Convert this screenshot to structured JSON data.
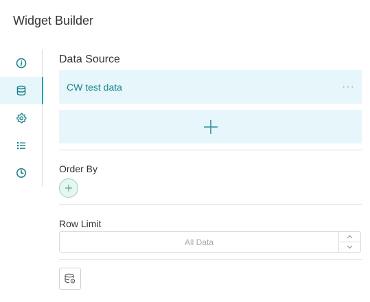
{
  "header": {
    "title": "Widget Builder"
  },
  "sidebar": {
    "active_index": 1,
    "icons": [
      "info-icon",
      "database-icon",
      "gear-icon",
      "list-icon",
      "clock-icon"
    ],
    "accent_color": "#1fa6a0",
    "icon_color": "#1a7f8a"
  },
  "data_source": {
    "label": "Data Source",
    "items": [
      {
        "name": "CW test data",
        "more": "···"
      }
    ],
    "add_icon": "plus-icon"
  },
  "order_by": {
    "label": "Order By",
    "add_icon": "plus-icon"
  },
  "row_limit": {
    "label": "Row Limit",
    "value": "",
    "placeholder": "All Data"
  },
  "footer": {
    "button_icon": "database-settings-icon"
  },
  "colors": {
    "panel_bg": "#e6f6fb",
    "text_accent": "#17858f",
    "divider": "#dcdcdc"
  }
}
